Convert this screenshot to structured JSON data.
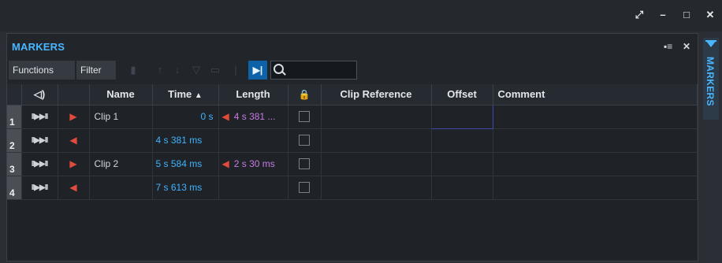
{
  "window": {
    "restore_label": "⤢",
    "minimize_label": "–",
    "maximize_label": "□",
    "close_label": "✕"
  },
  "panel": {
    "title": "MARKERS",
    "close_label": "✕",
    "menu_label": "▪≡"
  },
  "toolbar": {
    "functions_label": "Functions",
    "filter_label": "Filter",
    "search_value": "",
    "search_placeholder": ""
  },
  "columns": {
    "speaker": "◁)",
    "name": "Name",
    "time": "Time",
    "time_sort": "▲",
    "length": "Length",
    "lock": "🔒",
    "clip_reference": "Clip Reference",
    "offset": "Offset",
    "comment": "Comment"
  },
  "rows": [
    {
      "num": "1",
      "play": "II▶▶II",
      "marker": "▶",
      "name": "Clip 1",
      "time": "0 s",
      "length_marker": "◀",
      "length": "4 s 381 ..."
    },
    {
      "num": "2",
      "play": "II▶▶II",
      "marker": "◀",
      "name": "",
      "time": "4 s 381 ms",
      "length_marker": "",
      "length": ""
    },
    {
      "num": "3",
      "play": "II▶▶II",
      "marker": "▶",
      "name": "Clip 2",
      "time": "5 s 584 ms",
      "length_marker": "◀",
      "length": "2 s 30 ms"
    },
    {
      "num": "4",
      "play": "II▶▶II",
      "marker": "◀",
      "name": "",
      "time": "7 s 613 ms",
      "length_marker": "",
      "length": ""
    }
  ],
  "side_tab": {
    "label": "MARKERS"
  },
  "colors": {
    "accent": "#49b6ff",
    "marker_red": "#e24b3b",
    "length_purple": "#c77ae0",
    "active_button": "#0e62a8"
  }
}
